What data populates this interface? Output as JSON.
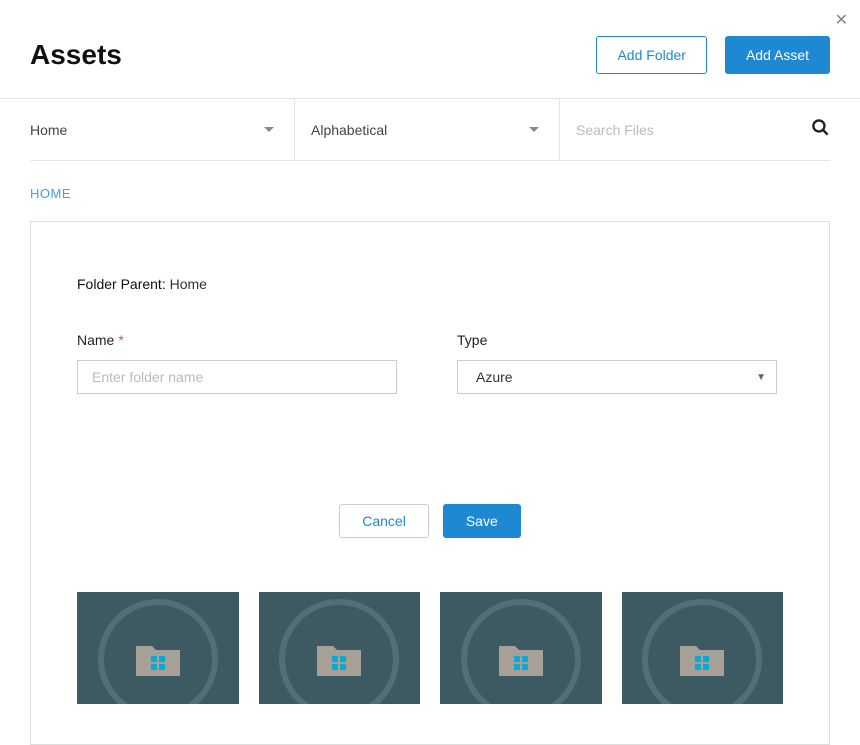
{
  "header": {
    "title": "Assets",
    "add_folder_label": "Add Folder",
    "add_asset_label": "Add Asset"
  },
  "filters": {
    "location": "Home",
    "sort": "Alphabetical",
    "search_placeholder": "Search Files"
  },
  "breadcrumb": {
    "home": "HOME"
  },
  "folder_form": {
    "parent_label": "Folder Parent:",
    "parent_value": "Home",
    "name_label": "Name",
    "name_placeholder": "Enter folder name",
    "name_value": "",
    "type_label": "Type",
    "type_value": "Azure",
    "cancel_label": "Cancel",
    "save_label": "Save"
  },
  "tiles": [
    {
      "icon": "windows-folder"
    },
    {
      "icon": "windows-folder"
    },
    {
      "icon": "windows-folder"
    },
    {
      "icon": "windows-folder"
    }
  ],
  "colors": {
    "primary": "#1e88d2",
    "tile_bg": "#3d5a63",
    "folder_fill": "#a6a096",
    "win_accent": "#0da7d4"
  }
}
